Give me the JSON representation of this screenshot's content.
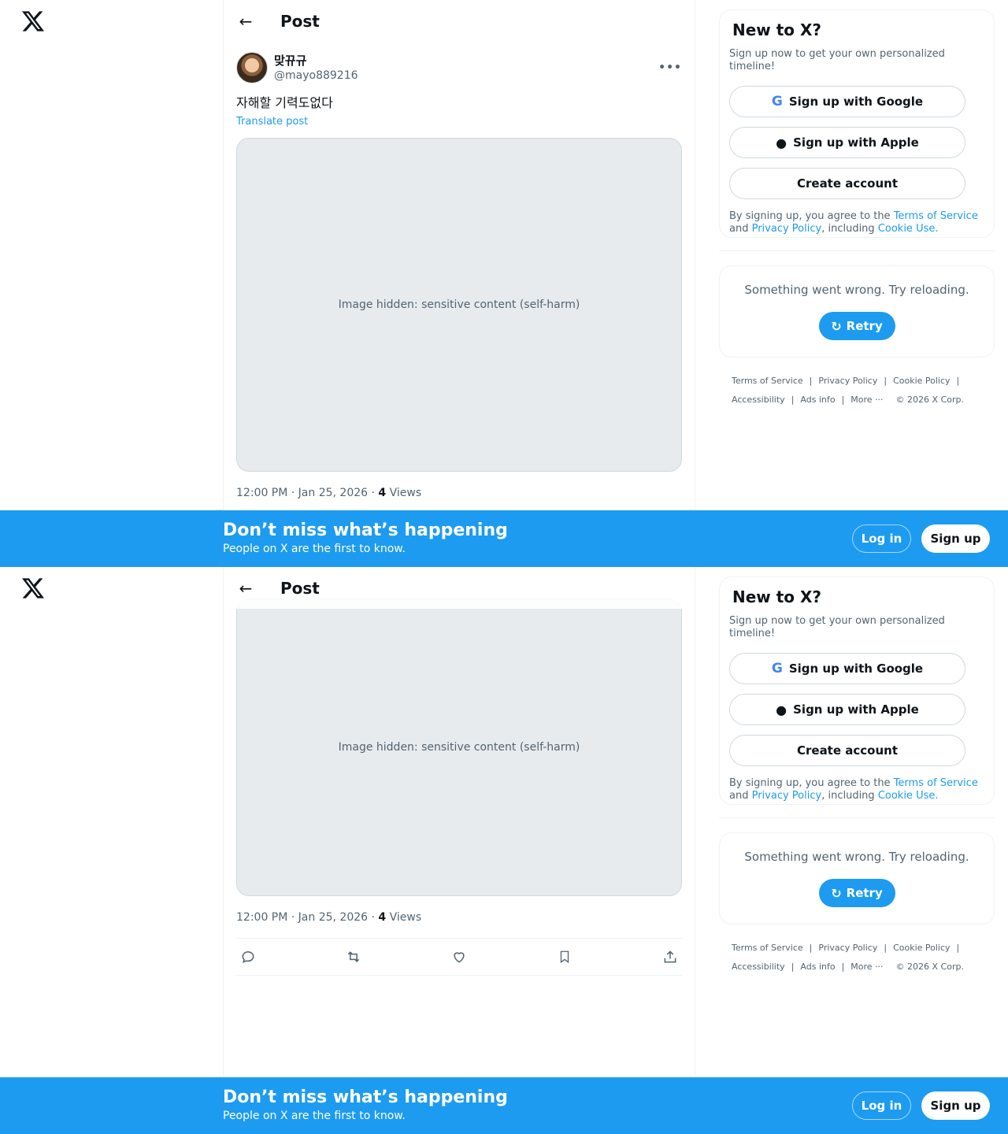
{
  "post": {
    "header_title": "Post",
    "display_name": "맞뀨규",
    "handle": "@mayo889216",
    "text": "자해할 기력도없다",
    "translate": "Translate post",
    "media_note": "Image hidden: sensitive content (self-harm)",
    "time": "12:00 PM · Jan 25, 2026 · ",
    "views_count": "4",
    "views_label": " Views"
  },
  "sidebar": {
    "title": "New to X?",
    "subtitle": "Sign up now to get your own personalized timeline!",
    "google": "Sign up with Google",
    "apple": "Sign up with Apple",
    "create": "Create account",
    "terms_prefix": "By signing up, you agree to the ",
    "terms_link": "Terms of Service",
    "terms_and": " and ",
    "privacy_link": "Privacy Policy",
    "terms_including": ", including ",
    "cookie_link": "Cookie Use.",
    "error": "Something went wrong. Try reloading.",
    "retry": "Retry"
  },
  "footer": {
    "tos": "Terms of Service",
    "privacy": "Privacy Policy",
    "cookie": "Cookie Policy",
    "accessibility": "Accessibility",
    "ads": "Ads info",
    "more": "More ···",
    "copyright": "© 2026 X Corp."
  },
  "banner": {
    "title": "Don’t miss what’s happening",
    "subtitle": "People on X are the first to know.",
    "login": "Log in",
    "signup": "Sign up"
  },
  "icons": [
    "x-logo-icon",
    "back-arrow-icon",
    "more-icon",
    "google-icon",
    "apple-icon",
    "refresh-icon",
    "reply-icon",
    "repost-icon",
    "like-icon",
    "bookmark-icon",
    "share-icon"
  ],
  "colors": {
    "accent": "#1d9bf0",
    "text": "#0f1419",
    "muted": "#536471",
    "border": "#eff3f4"
  }
}
